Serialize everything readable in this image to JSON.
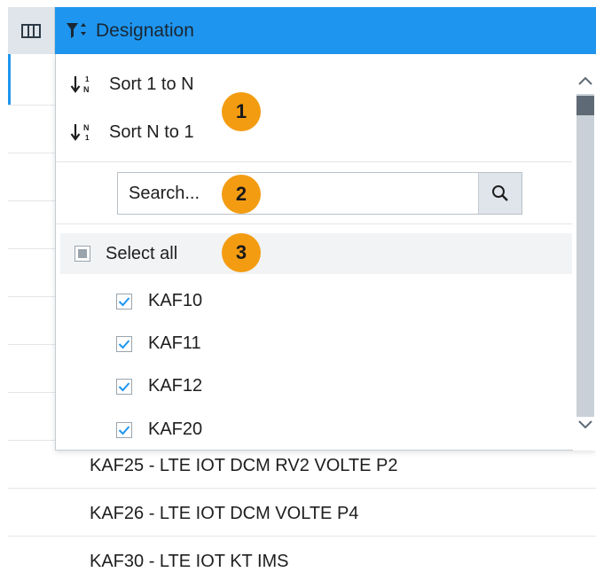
{
  "header": {
    "title": "Designation"
  },
  "sort": {
    "asc_label": "Sort 1 to N",
    "desc_label": "Sort N to 1"
  },
  "search": {
    "placeholder": "Search..."
  },
  "select_all": {
    "label": "Select all"
  },
  "options": [
    {
      "label": "KAF10",
      "checked": true
    },
    {
      "label": "KAF11",
      "checked": true
    },
    {
      "label": "KAF12",
      "checked": true
    },
    {
      "label": "KAF20",
      "checked": true
    }
  ],
  "badges": [
    "1",
    "2",
    "3"
  ],
  "rows": [
    "KAF25 - LTE IOT DCM RV2 VOLTE P2",
    "KAF26 - LTE IOT DCM VOLTE P4",
    "KAF30 - LTE IOT KT IMS"
  ],
  "colors": {
    "header_bg": "#1e96f0",
    "badge": "#f39c12",
    "accent": "#1e96f0"
  }
}
